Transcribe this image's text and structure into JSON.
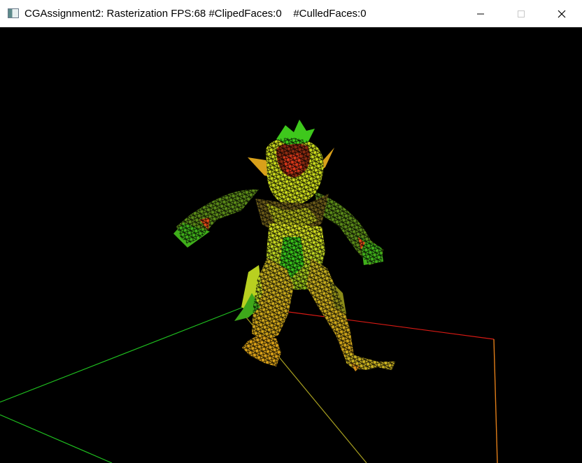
{
  "window": {
    "title": "CGAssignment2: Rasterization FPS:68 #ClipedFaces:0    #CulledFaces:0",
    "icon": "app-window-icon",
    "controls": {
      "minimize_icon": "minimize-icon",
      "maximize_icon": "maximize-icon",
      "close_icon": "close-icon"
    }
  },
  "viewport": {
    "background": "#000000",
    "content": "wireframe-creature-model",
    "axis_colors": {
      "x": "#e0201a",
      "y": "#d9a020",
      "z": "#20c020"
    }
  }
}
